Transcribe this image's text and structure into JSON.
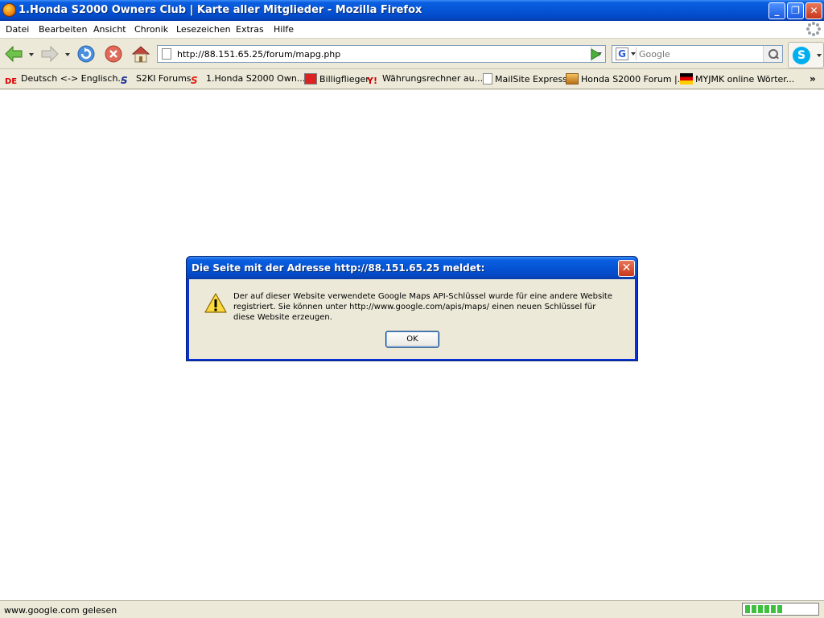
{
  "window": {
    "title": "1.Honda S2000 Owners Club | Karte aller Mitglieder - Mozilla Firefox",
    "minimize_label": "_",
    "maximize_label": "❐",
    "close_label": "✕"
  },
  "menu": {
    "items": [
      "Datei",
      "Bearbeiten",
      "Ansicht",
      "Chronik",
      "Lesezeichen",
      "Extras",
      "Hilfe"
    ]
  },
  "toolbar": {
    "url": "http://88.151.65.25/forum/mapg.php",
    "search_placeholder": "Google",
    "search_engine_letter": "G",
    "skype_letter": "S",
    "icons": [
      "back-icon",
      "forward-icon",
      "reload-icon",
      "stop-icon",
      "home-icon",
      "go-icon",
      "search-icon"
    ]
  },
  "bookmarks": {
    "items": [
      "Deutsch <-> Englisch...",
      "S2KI Forums",
      "1.Honda S2000 Own...",
      "Billigflieger",
      "Währungsrechner au...",
      "MailSite Express",
      "Honda S2000 Forum |...",
      "MYJMK online Wörter..."
    ],
    "more_label": "»"
  },
  "dialog": {
    "title": "Die Seite mit der Adresse http://88.151.65.25 meldet:",
    "message": "Der auf dieser Website verwendete Google Maps API-Schlüssel wurde für eine andere Website registriert. Sie können unter http://www.google.com/apis/maps/ einen neuen Schlüssel für diese Website erzeugen.",
    "ok_label": "OK",
    "close_label": "✕"
  },
  "status": {
    "text": "www.google.com gelesen",
    "progress_segments": 6
  },
  "colors": {
    "titlebar": "#0554d6",
    "dialog_frame": "#0831d9",
    "close_red": "#c8381c",
    "progress_green": "#3ec03e"
  }
}
